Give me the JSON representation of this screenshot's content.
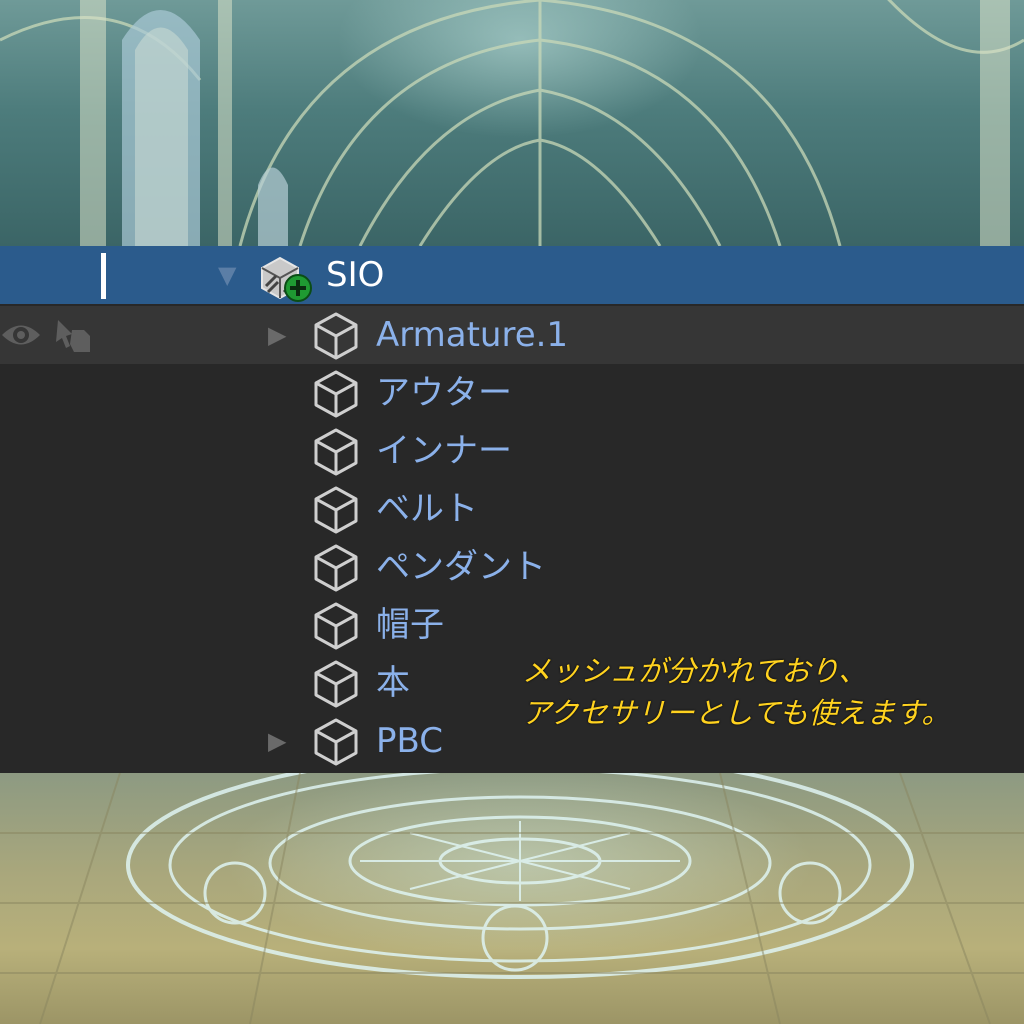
{
  "outliner": {
    "collection": {
      "label": "SIO",
      "expanded": true
    },
    "items": [
      {
        "label": "Armature.1",
        "expandable": true
      },
      {
        "label": "アウター",
        "expandable": false
      },
      {
        "label": "インナー",
        "expandable": false
      },
      {
        "label": "ベルト",
        "expandable": false
      },
      {
        "label": "ペンダント",
        "expandable": false
      },
      {
        "label": "帽子",
        "expandable": false
      },
      {
        "label": "本",
        "expandable": false
      },
      {
        "label": "PBC",
        "expandable": true
      }
    ],
    "icons": {
      "collection": "collection-add-icon",
      "object": "mesh-cube-icon",
      "visibility": "eye-icon",
      "select": "pointer-hand-icon"
    },
    "colors": {
      "selected_row": "#2b5b8c",
      "panel_bg": "#282828",
      "item_text": "#8bb1ea"
    }
  },
  "caption": {
    "line1": "メッシュが分かれており、",
    "line2": "アクセサリーとしても使えます。",
    "color": "#ffd21f"
  }
}
